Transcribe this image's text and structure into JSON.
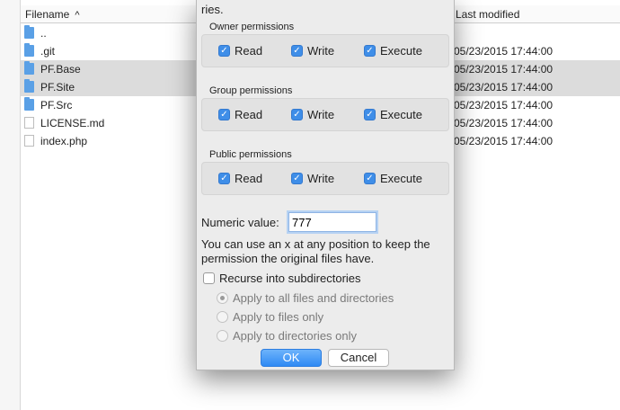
{
  "file_list": {
    "columns": {
      "filename": "Filename",
      "last_modified": "Last modified"
    },
    "rows": [
      {
        "name": "..",
        "type": "folder",
        "modified": "",
        "selected": false
      },
      {
        "name": ".git",
        "type": "folder",
        "modified": "05/23/2015 17:44:00",
        "selected": false
      },
      {
        "name": "PF.Base",
        "type": "folder",
        "modified": "05/23/2015 17:44:00",
        "selected": true
      },
      {
        "name": "PF.Site",
        "type": "folder",
        "modified": "05/23/2015 17:44:00",
        "selected": true
      },
      {
        "name": "PF.Src",
        "type": "folder",
        "modified": "05/23/2015 17:44:00",
        "selected": false
      },
      {
        "name": "LICENSE.md",
        "type": "file",
        "modified": "05/23/2015 17:44:00",
        "selected": false
      },
      {
        "name": "index.php",
        "type": "file",
        "modified": "05/23/2015 17:44:00",
        "selected": false
      }
    ]
  },
  "dialog": {
    "header_fragment": "ries.",
    "groups": [
      {
        "title": "Owner permissions",
        "read": "Read",
        "write": "Write",
        "execute": "Execute"
      },
      {
        "title": "Group permissions",
        "read": "Read",
        "write": "Write",
        "execute": "Execute"
      },
      {
        "title": "Public permissions",
        "read": "Read",
        "write": "Write",
        "execute": "Execute"
      }
    ],
    "numeric_label": "Numeric value:",
    "numeric_value": "777",
    "hint_line1": "You can use an x at any position to keep the",
    "hint_line2": "permission the original files have.",
    "recurse_label": "Recurse into subdirectories",
    "radio_options": [
      "Apply to all files and directories",
      "Apply to files only",
      "Apply to directories only"
    ],
    "ok_label": "OK",
    "cancel_label": "Cancel"
  },
  "colors": {
    "accent": "#3f8ee8",
    "selection": "#dcdcdc",
    "dialog_bg": "#ececec",
    "folder": "#5aa0e6"
  }
}
